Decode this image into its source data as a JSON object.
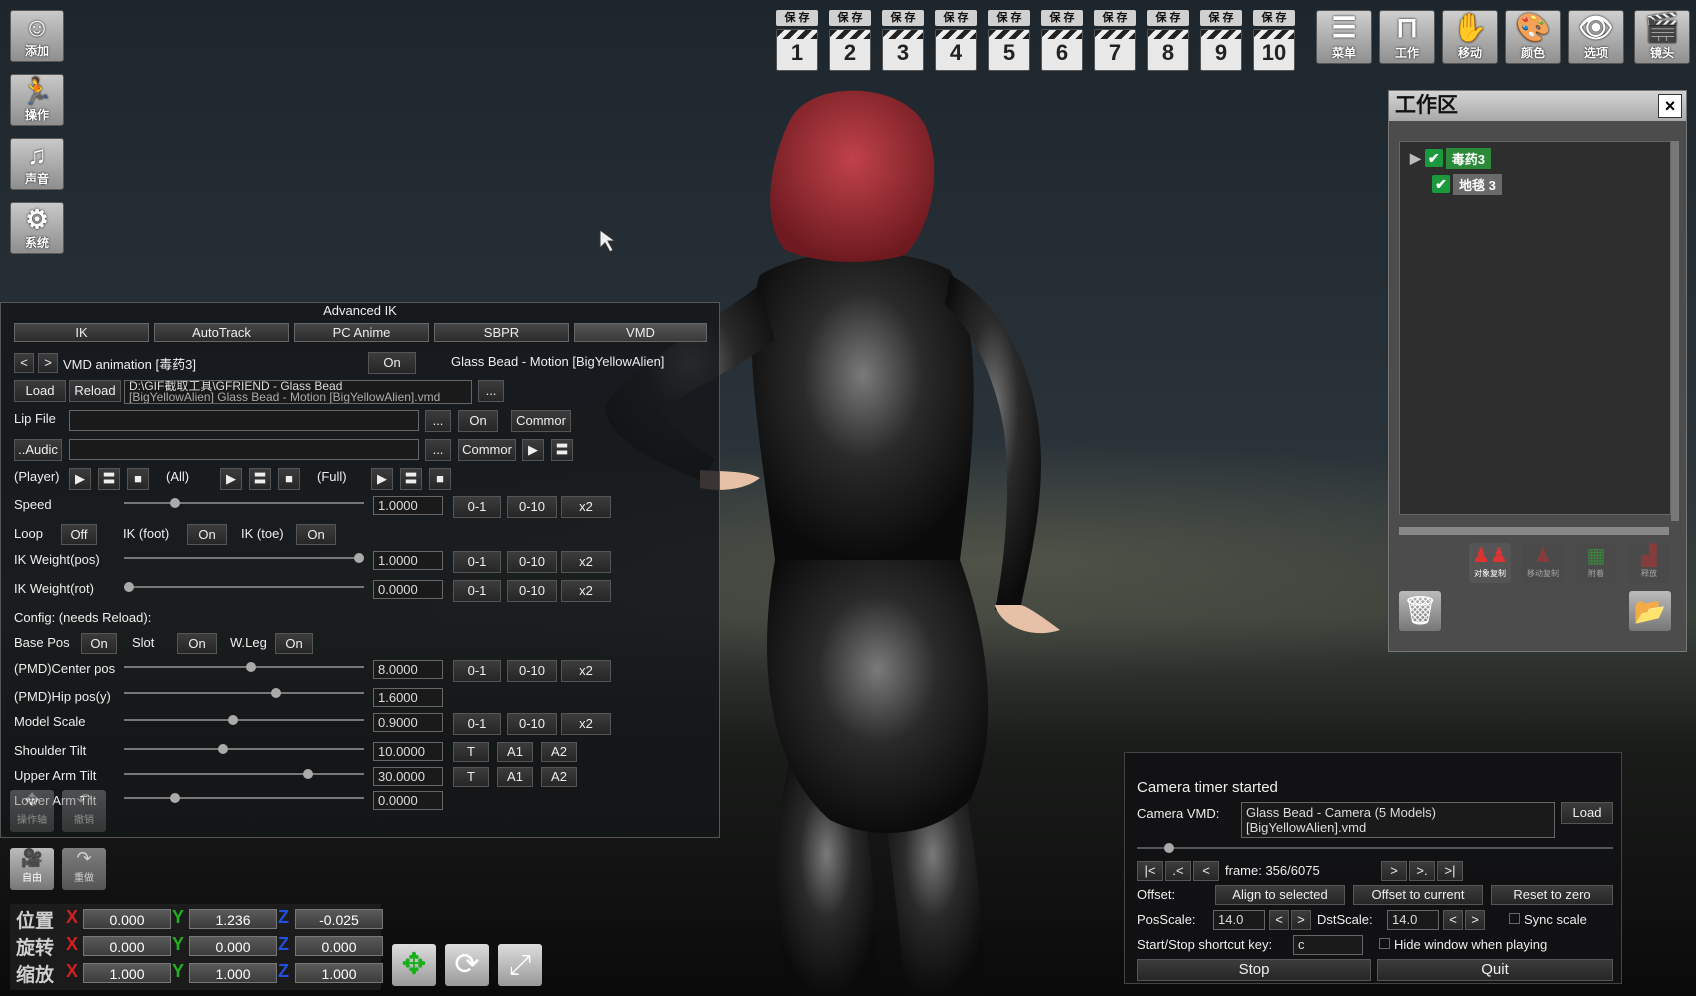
{
  "left_tools": [
    {
      "label": "添加",
      "icon": "add-person-icon"
    },
    {
      "label": "操作",
      "icon": "running-person-icon"
    },
    {
      "label": "声音",
      "icon": "music-note-icon"
    },
    {
      "label": "系统",
      "icon": "gears-icon"
    }
  ],
  "save_slots": {
    "label": "保 存",
    "numbers": [
      "1",
      "2",
      "3",
      "4",
      "5",
      "6",
      "7",
      "8",
      "9",
      "10"
    ]
  },
  "right_tools": [
    {
      "label": "菜单",
      "icon": "menu-list-icon"
    },
    {
      "label": "工作",
      "icon": "work-frame-icon"
    },
    {
      "label": "移动",
      "icon": "hand-icon"
    },
    {
      "label": "颜色",
      "icon": "palette-icon"
    },
    {
      "label": "选项",
      "icon": "eye-icon"
    },
    {
      "label": "镜头",
      "icon": "camera-clapper-icon"
    }
  ],
  "workspace": {
    "title": "工作区",
    "close": "×",
    "items": [
      {
        "label": "毒药3",
        "selected": true
      },
      {
        "label": "地毯 3",
        "selected": false
      }
    ],
    "tool_labels": [
      "对象复制",
      "移动复制",
      "附着",
      "释放"
    ]
  },
  "ik_panel": {
    "title": "Advanced IK",
    "tabs": [
      "IK",
      "AutoTrack",
      "PC Anime",
      "SBPR",
      "VMD"
    ],
    "prev": "<",
    "next": ">",
    "vmd_title": "VMD animation [毒药3]",
    "vmd_on": "On",
    "motion_name": "Glass Bead - Motion [BigYellowAlien]",
    "load": "Load",
    "reload": "Reload",
    "vmd_path": "D:\\GIF截取工具\\GFRIEND - Glass Bead",
    "vmd_path_line2": "[BigYellowAlien] Glass Bead - Motion [BigYellowAlien].vmd",
    "browse": "...",
    "lip_label": "Lip File",
    "lip_value": "",
    "lip_on": "On",
    "lip_common": "Commor",
    "audio_label": "..Audic",
    "audio_value": "",
    "audio_common": "Commor",
    "player_label": "(Player)",
    "all_label": "(All)",
    "full_label": "(Full)",
    "speed_label": "Speed",
    "speed_value": "1.0000",
    "r01": "0-1",
    "r010": "0-10",
    "x2": "x2",
    "loop_label": "Loop",
    "loop_value": "Off",
    "ikfoot_label": "IK (foot)",
    "ikfoot_value": "On",
    "iktoe_label": "IK (toe)",
    "iktoe_value": "On",
    "ikw_pos_label": "IK Weight(pos)",
    "ikw_pos_value": "1.0000",
    "ikw_rot_label": "IK Weight(rot)",
    "ikw_rot_value": "0.0000",
    "config_label": "Config: (needs Reload):",
    "basepos_label": "Base Pos",
    "basepos_value": "On",
    "slot_label": "Slot",
    "slot_value": "On",
    "wleg_label": "W.Leg",
    "wleg_value": "On",
    "center_label": "(PMD)Center pos",
    "center_value": "8.0000",
    "hip_label": "(PMD)Hip pos(y)",
    "hip_value": "1.6000",
    "scale_label": "Model Scale",
    "scale_value": "0.9000",
    "shoulder_label": "Shoulder Tilt",
    "shoulder_value": "10.0000",
    "upperarm_label": "Upper Arm Tilt",
    "upperarm_value": "30.0000",
    "lowerarm_label": "Lower Arm Tilt",
    "lowerarm_value": "0.0000",
    "T": "T",
    "A1": "A1",
    "A2": "A2",
    "sliders": {
      "speed": 0.2,
      "ikw_pos": 1.0,
      "ikw_rot": 0.0,
      "center": 0.53,
      "hip": 0.64,
      "scale": 0.45,
      "shoulder": 0.41,
      "upperarm": 0.78,
      "lowerarm": 0.2
    }
  },
  "bottom_tools": [
    {
      "label": "操作轴",
      "icon": "axis-icon"
    },
    {
      "label": "撤销",
      "icon": "undo-icon"
    },
    {
      "label": "自由",
      "icon": "camera-icon"
    },
    {
      "label": "重做",
      "icon": "redo-icon"
    }
  ],
  "transform": {
    "pos_label": "位置",
    "rot_label": "旋转",
    "scale_label": "缩放",
    "x": "X",
    "y": "Y",
    "z": "Z",
    "pos": [
      "0.000",
      "1.236",
      "-0.025"
    ],
    "rot": [
      "0.000",
      "0.000",
      "0.000"
    ],
    "scale": [
      "1.000",
      "1.000",
      "1.000"
    ]
  },
  "camera": {
    "status": "Camera timer started",
    "vmd_label": "Camera VMD:",
    "vmd_line1": "Glass Bead - Camera (5 Models)",
    "vmd_line2": "[BigYellowAlien].vmd",
    "load": "Load",
    "first": "|<",
    "prev_fast": ".<",
    "prev": "<",
    "frame": "frame: 356/6075",
    "next": ">",
    "next_fast": ">.",
    "last": ">|",
    "offset_label": "Offset:",
    "align": "Align to selected",
    "offset_current": "Offset to current",
    "reset": "Reset to zero",
    "posscale_label": "PosScale:",
    "posscale_value": "14.0",
    "dstscale_label": "DstScale:",
    "dstscale_value": "14.0",
    "sync": "Sync scale",
    "shortcut_label": "Start/Stop shortcut key:",
    "shortcut_value": "c",
    "hide": "Hide window when playing",
    "stop": "Stop",
    "quit": "Quit",
    "progress": 0.059
  }
}
